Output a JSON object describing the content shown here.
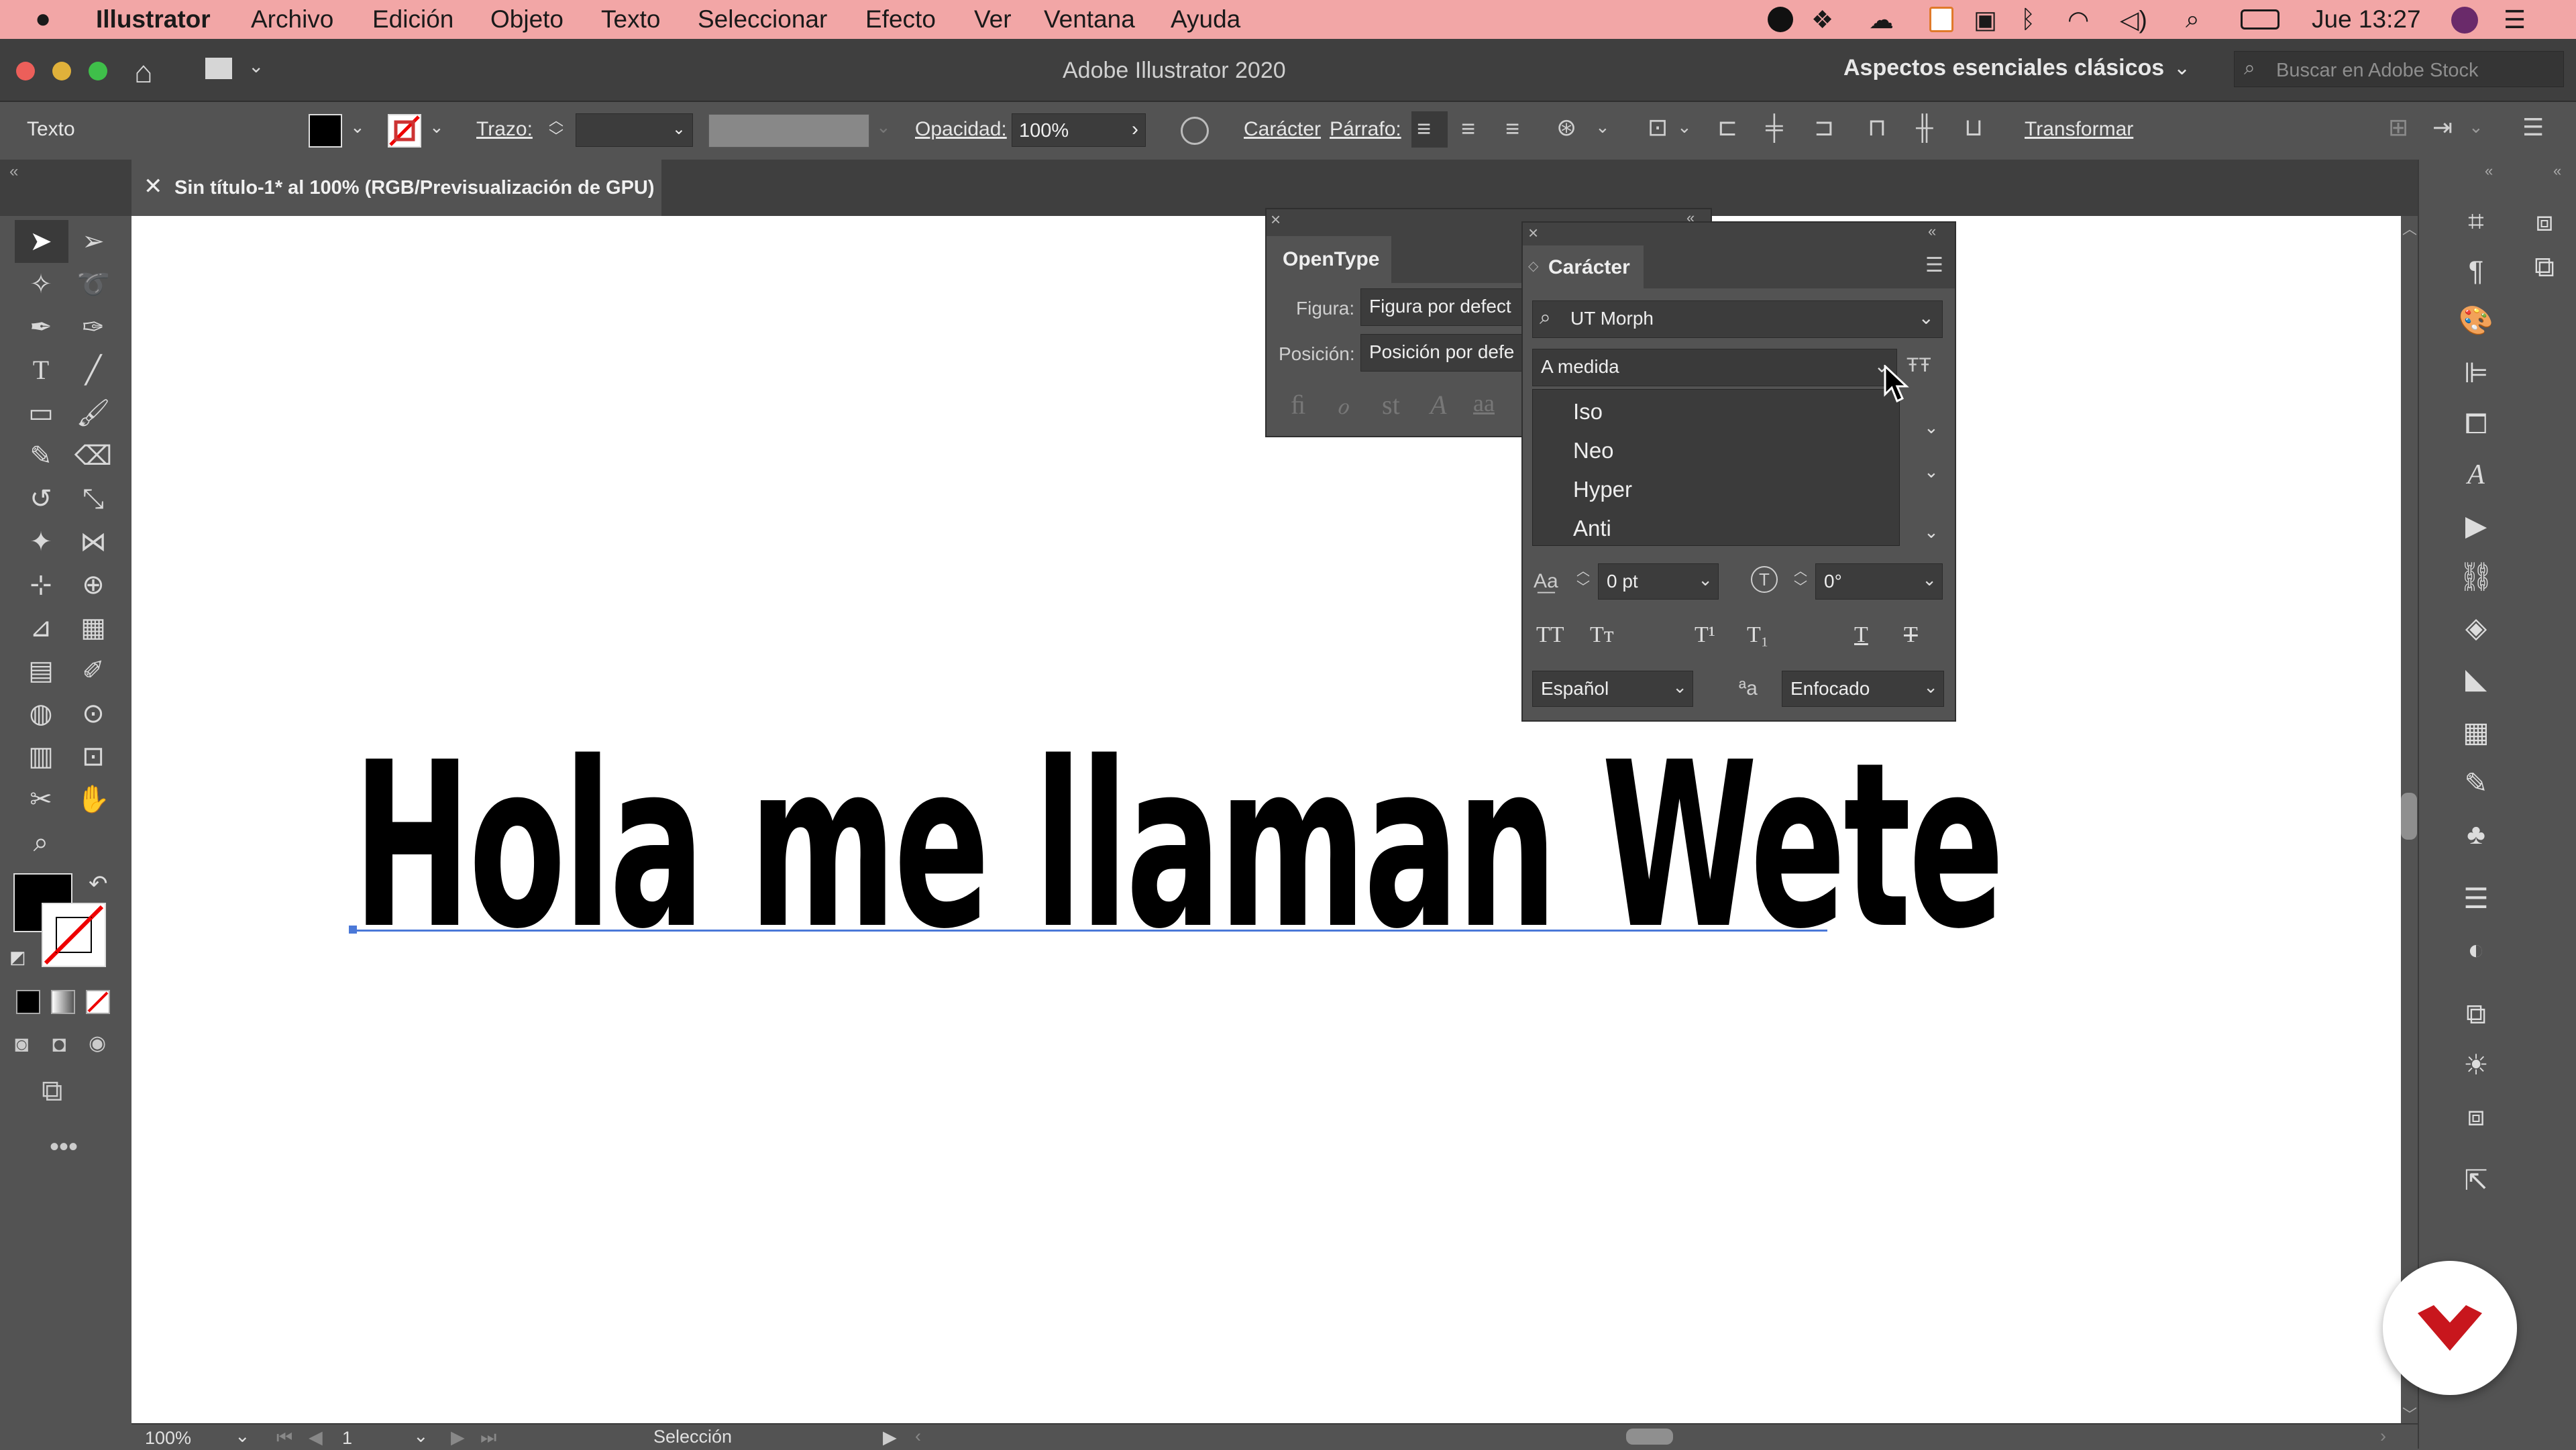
{
  "menubar": {
    "app_name": "Illustrator",
    "items": [
      "Archivo",
      "Edición",
      "Objeto",
      "Texto",
      "Seleccionar",
      "Efecto",
      "Ver",
      "Ventana",
      "Ayuda"
    ],
    "clock": "Jue 13:27"
  },
  "titlebar": {
    "window_title": "Adobe Illustrator 2020",
    "workspace": "Aspectos esenciales clásicos",
    "search_placeholder": "Buscar en Adobe Stock"
  },
  "controlbar": {
    "context": "Texto",
    "stroke_label": "Trazo:",
    "opacity_label": "Opacidad:",
    "opacity_value": "100%",
    "character_link": "Carácter",
    "paragraph_link": "Párrafo:",
    "transform_link": "Transformar"
  },
  "document": {
    "tab_title": "Sin título-1* al 100% (RGB/Previsualización de GPU)",
    "artwork_text": "Hola me llaman Wete",
    "accent": "#4a78d8"
  },
  "opentype_panel": {
    "title": "OpenType",
    "figure_label": "Figura:",
    "figure_value": "Figura por defect",
    "position_label": "Posición:",
    "position_value": "Posición por defe"
  },
  "character_panel": {
    "title": "Carácter",
    "font_family": "UT Morph",
    "font_style": "A medida",
    "style_options": [
      "Iso",
      "Neo",
      "Hyper",
      "Anti"
    ],
    "baseline_shift": "0 pt",
    "rotation": "0°",
    "language": "Español",
    "antialias": "Enfocado",
    "antialias_icon_text": "ªa"
  },
  "statusbar": {
    "zoom": "100%",
    "artboard": "1",
    "tool": "Selección"
  },
  "logo": {
    "color": "#c8161d"
  }
}
